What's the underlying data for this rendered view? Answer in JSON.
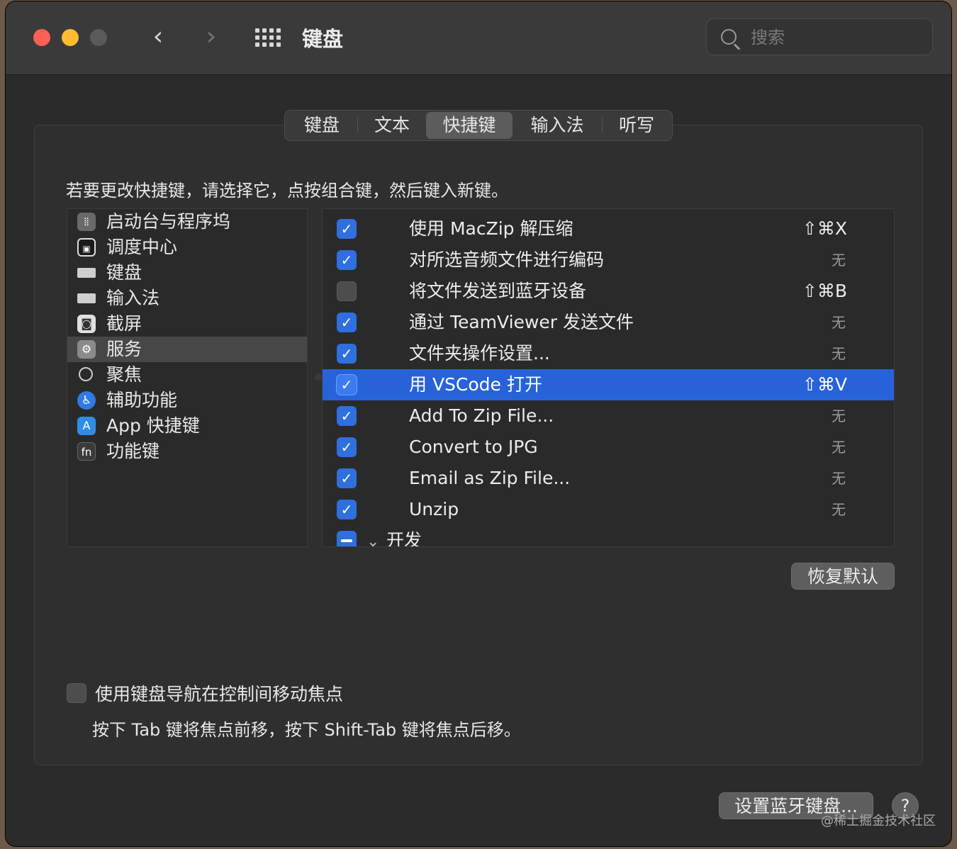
{
  "window": {
    "title": "键盘",
    "search_placeholder": "搜索"
  },
  "tabs": [
    {
      "label": "键盘",
      "active": false
    },
    {
      "label": "文本",
      "active": false
    },
    {
      "label": "快捷键",
      "active": true
    },
    {
      "label": "输入法",
      "active": false
    },
    {
      "label": "听写",
      "active": false
    }
  ],
  "hint": "若要更改快捷键，请选择它，点按组合键，然后键入新键。",
  "categories": [
    {
      "label": "启动台与程序坞",
      "icon": "launchpad-icon",
      "selected": false
    },
    {
      "label": "调度中心",
      "icon": "mission-control-icon",
      "selected": false
    },
    {
      "label": "键盘",
      "icon": "keyboard-icon",
      "selected": false
    },
    {
      "label": "输入法",
      "icon": "keyboard-icon",
      "selected": false
    },
    {
      "label": "截屏",
      "icon": "screenshot-icon",
      "selected": false
    },
    {
      "label": "服务",
      "icon": "gear-icon",
      "selected": true
    },
    {
      "label": "聚焦",
      "icon": "spotlight-icon",
      "selected": false
    },
    {
      "label": "辅助功能",
      "icon": "accessibility-icon",
      "selected": false
    },
    {
      "label": "App 快捷键",
      "icon": "app-store-icon",
      "selected": false
    },
    {
      "label": "功能键",
      "icon": "fn-icon",
      "selected": false
    }
  ],
  "shortcuts": [
    {
      "label": "使用 MacZip 解压缩",
      "key": "⇧⌘X",
      "checked": true,
      "selected": false
    },
    {
      "label": "对所选音频文件进行编码",
      "key": "无",
      "checked": true,
      "selected": false
    },
    {
      "label": "将文件发送到蓝牙设备",
      "key": "⇧⌘B",
      "checked": false,
      "selected": false
    },
    {
      "label": "通过 TeamViewer 发送文件",
      "key": "无",
      "checked": true,
      "selected": false
    },
    {
      "label": "文件夹操作设置...",
      "key": "无",
      "checked": true,
      "selected": false
    },
    {
      "label": "用 VSCode 打开",
      "key": "⇧⌘V",
      "checked": true,
      "selected": true
    },
    {
      "label": "Add To Zip File...",
      "key": "无",
      "checked": true,
      "selected": false
    },
    {
      "label": "Convert to JPG",
      "key": "无",
      "checked": true,
      "selected": false
    },
    {
      "label": "Email as Zip File...",
      "key": "无",
      "checked": true,
      "selected": false
    },
    {
      "label": "Unzip",
      "key": "无",
      "checked": true,
      "selected": false
    }
  ],
  "group": {
    "label": "开发",
    "state": "mixed"
  },
  "buttons": {
    "restore": "恢复默认",
    "bluetooth": "设置蓝牙键盘...",
    "help": "?"
  },
  "keyboard_nav": {
    "label": "使用键盘导航在控制间移动焦点",
    "checked": false,
    "note": "按下 Tab 键将焦点前移，按下 Shift-Tab 键将焦点后移。"
  },
  "watermark": "@稀土掘金技术社区",
  "colors": {
    "accent": "#2862d8",
    "checkbox_on": "#2f6fde",
    "close": "#fe5f57",
    "minimize": "#febc2e"
  }
}
